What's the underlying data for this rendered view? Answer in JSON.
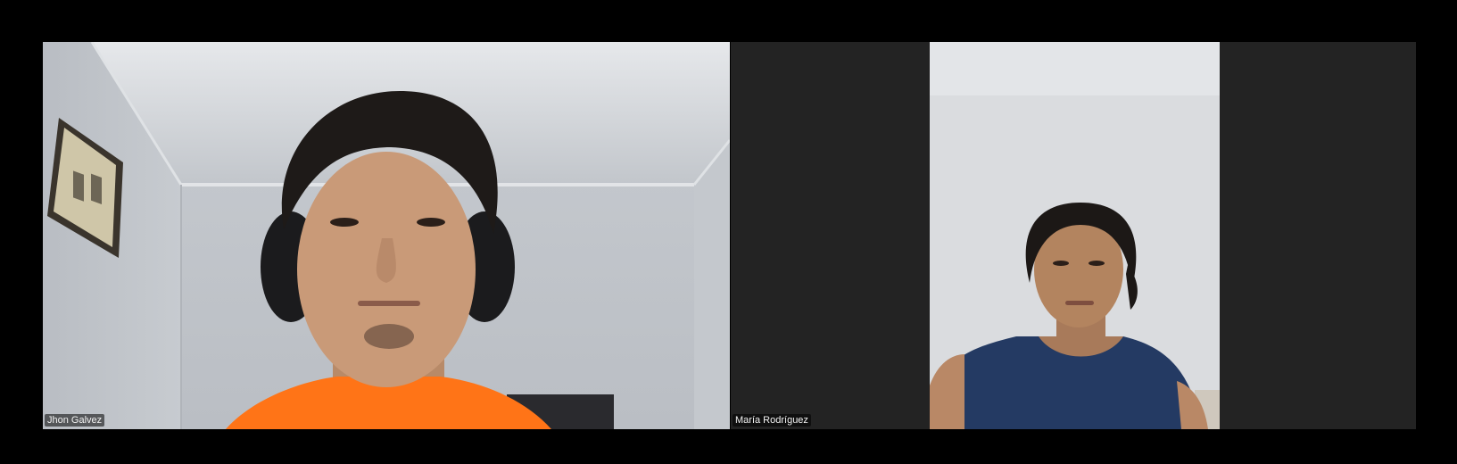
{
  "participants": [
    {
      "name": "Jhon Galvez"
    },
    {
      "name": "María Rodríguez"
    }
  ],
  "colors": {
    "background": "#000000",
    "tile_dark": "#232323",
    "name_label_bg": "rgba(0,0,0,0.55)",
    "name_label_text": "#f2f2f2"
  }
}
